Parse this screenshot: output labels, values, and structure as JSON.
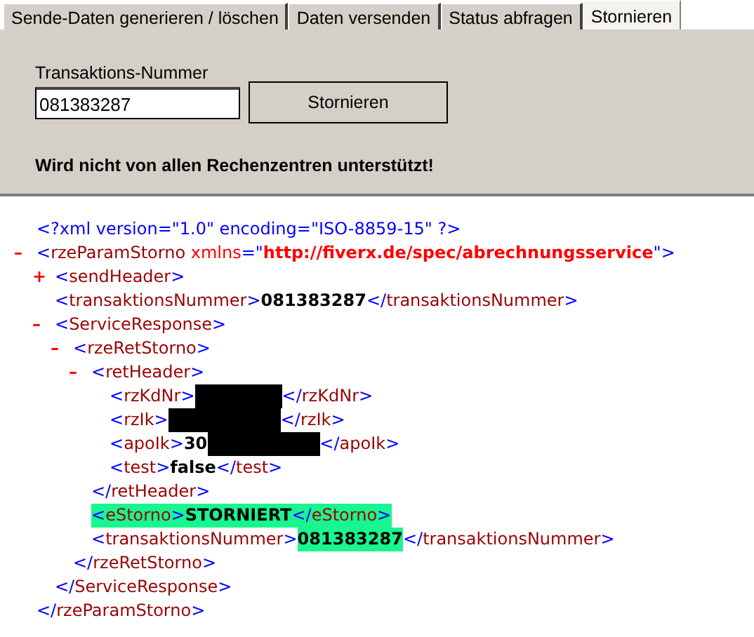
{
  "tabs": [
    {
      "label": "Sende-Daten generieren / löschen",
      "selected": false
    },
    {
      "label": "Daten versenden",
      "selected": false
    },
    {
      "label": "Status abfragen",
      "selected": false
    },
    {
      "label": "Stornieren",
      "selected": true
    }
  ],
  "form": {
    "field_label": "Transaktions-Nummer",
    "field_value": "081383287",
    "button": "Stornieren",
    "note": "Wird nicht von allen Rechenzentren unterstützt!"
  },
  "xml_view": {
    "declaration": "<?xml version=\"1.0\" encoding=\"ISO-8859-15\" ?>",
    "nodes": [
      {
        "toggle": "–",
        "line": [
          {
            "kind": "bracket",
            "text": "<"
          },
          {
            "kind": "tag",
            "text": "rzeParamStorno"
          },
          {
            "kind": "attr",
            "text": " xmlns"
          },
          {
            "kind": "bracket",
            "text": "=\""
          },
          {
            "kind": "attrval",
            "text": "http://fiverx.de/spec/abrechnungsservice"
          },
          {
            "kind": "bracket",
            "text": "\">"
          }
        ],
        "close": [
          {
            "kind": "bracket",
            "text": "</"
          },
          {
            "kind": "tag",
            "text": "rzeParamStorno"
          },
          {
            "kind": "bracket",
            "text": ">"
          }
        ],
        "children": [
          {
            "toggle": "+",
            "line": [
              {
                "kind": "bracket",
                "text": "<"
              },
              {
                "kind": "tag",
                "text": "sendHeader"
              },
              {
                "kind": "bracket",
                "text": ">"
              }
            ]
          },
          {
            "line": [
              {
                "kind": "bracket",
                "text": "<"
              },
              {
                "kind": "tag",
                "text": "transaktionsNummer"
              },
              {
                "kind": "bracket",
                "text": ">"
              },
              {
                "kind": "value",
                "text": "081383287"
              },
              {
                "kind": "bracket",
                "text": "</"
              },
              {
                "kind": "tag",
                "text": "transaktionsNummer"
              },
              {
                "kind": "bracket",
                "text": ">"
              }
            ]
          },
          {
            "toggle": "–",
            "line": [
              {
                "kind": "bracket",
                "text": "<"
              },
              {
                "kind": "tag",
                "text": "ServiceResponse"
              },
              {
                "kind": "bracket",
                "text": ">"
              }
            ],
            "close": [
              {
                "kind": "bracket",
                "text": "</"
              },
              {
                "kind": "tag",
                "text": "ServiceResponse"
              },
              {
                "kind": "bracket",
                "text": ">"
              }
            ],
            "children": [
              {
                "toggle": "–",
                "line": [
                  {
                    "kind": "bracket",
                    "text": "<"
                  },
                  {
                    "kind": "tag",
                    "text": "rzeRetStorno"
                  },
                  {
                    "kind": "bracket",
                    "text": ">"
                  }
                ],
                "close": [
                  {
                    "kind": "bracket",
                    "text": "</"
                  },
                  {
                    "kind": "tag",
                    "text": "rzeRetStorno"
                  },
                  {
                    "kind": "bracket",
                    "text": ">"
                  }
                ],
                "children": [
                  {
                    "toggle": "–",
                    "line": [
                      {
                        "kind": "bracket",
                        "text": "<"
                      },
                      {
                        "kind": "tag",
                        "text": "retHeader"
                      },
                      {
                        "kind": "bracket",
                        "text": ">"
                      }
                    ],
                    "close": [
                      {
                        "kind": "bracket",
                        "text": "</"
                      },
                      {
                        "kind": "tag",
                        "text": "retHeader"
                      },
                      {
                        "kind": "bracket",
                        "text": ">"
                      }
                    ],
                    "children": [
                      {
                        "line": [
                          {
                            "kind": "bracket",
                            "text": "<"
                          },
                          {
                            "kind": "tag",
                            "text": "rzKdNr"
                          },
                          {
                            "kind": "bracket",
                            "text": ">"
                          },
                          {
                            "kind": "redacted-short"
                          },
                          {
                            "kind": "bracket",
                            "text": "</"
                          },
                          {
                            "kind": "tag",
                            "text": "rzKdNr"
                          },
                          {
                            "kind": "bracket",
                            "text": ">"
                          }
                        ]
                      },
                      {
                        "line": [
                          {
                            "kind": "bracket",
                            "text": "<"
                          },
                          {
                            "kind": "tag",
                            "text": "rzIk"
                          },
                          {
                            "kind": "bracket",
                            "text": ">"
                          },
                          {
                            "kind": "redacted-long"
                          },
                          {
                            "kind": "bracket",
                            "text": "</"
                          },
                          {
                            "kind": "tag",
                            "text": "rzIk"
                          },
                          {
                            "kind": "bracket",
                            "text": ">"
                          }
                        ]
                      },
                      {
                        "line": [
                          {
                            "kind": "bracket",
                            "text": "<"
                          },
                          {
                            "kind": "tag",
                            "text": "apoIk"
                          },
                          {
                            "kind": "bracket",
                            "text": ">"
                          },
                          {
                            "kind": "value",
                            "text": "30"
                          },
                          {
                            "kind": "redacted-long"
                          },
                          {
                            "kind": "bracket",
                            "text": "</"
                          },
                          {
                            "kind": "tag",
                            "text": "apoIk"
                          },
                          {
                            "kind": "bracket",
                            "text": ">"
                          }
                        ]
                      },
                      {
                        "line": [
                          {
                            "kind": "bracket",
                            "text": "<"
                          },
                          {
                            "kind": "tag",
                            "text": "test"
                          },
                          {
                            "kind": "bracket",
                            "text": ">"
                          },
                          {
                            "kind": "value",
                            "text": "false"
                          },
                          {
                            "kind": "bracket",
                            "text": "</"
                          },
                          {
                            "kind": "tag",
                            "text": "test"
                          },
                          {
                            "kind": "bracket",
                            "text": ">"
                          }
                        ]
                      }
                    ]
                  },
                  {
                    "line": [
                      {
                        "kind": "bracket",
                        "text": "<",
                        "highlighted": true
                      },
                      {
                        "kind": "tag",
                        "text": "eStorno",
                        "highlighted": true
                      },
                      {
                        "kind": "bracket",
                        "text": ">",
                        "highlighted": true
                      },
                      {
                        "kind": "value",
                        "text": "STORNIERT",
                        "highlighted": true
                      },
                      {
                        "kind": "bracket",
                        "text": "</",
                        "highlighted": true
                      },
                      {
                        "kind": "tag",
                        "text": "eStorno",
                        "highlighted": true
                      },
                      {
                        "kind": "bracket",
                        "text": ">",
                        "highlighted": true
                      }
                    ]
                  },
                  {
                    "line": [
                      {
                        "kind": "bracket",
                        "text": "<",
                        "highlighted": false
                      },
                      {
                        "kind": "tag",
                        "text": "transaktionsNummer",
                        "highlighted": false
                      },
                      {
                        "kind": "bracket",
                        "text": ">",
                        "highlighted": false
                      },
                      {
                        "kind": "value",
                        "text": "081383287",
                        "highlighted": true
                      },
                      {
                        "kind": "bracket",
                        "text": "</",
                        "highlighted": false
                      },
                      {
                        "kind": "tag",
                        "text": "transaktionsNummer",
                        "highlighted": false
                      },
                      {
                        "kind": "bracket",
                        "text": ">",
                        "highlighted": false
                      }
                    ]
                  }
                ]
              }
            ]
          }
        ]
      }
    ]
  }
}
